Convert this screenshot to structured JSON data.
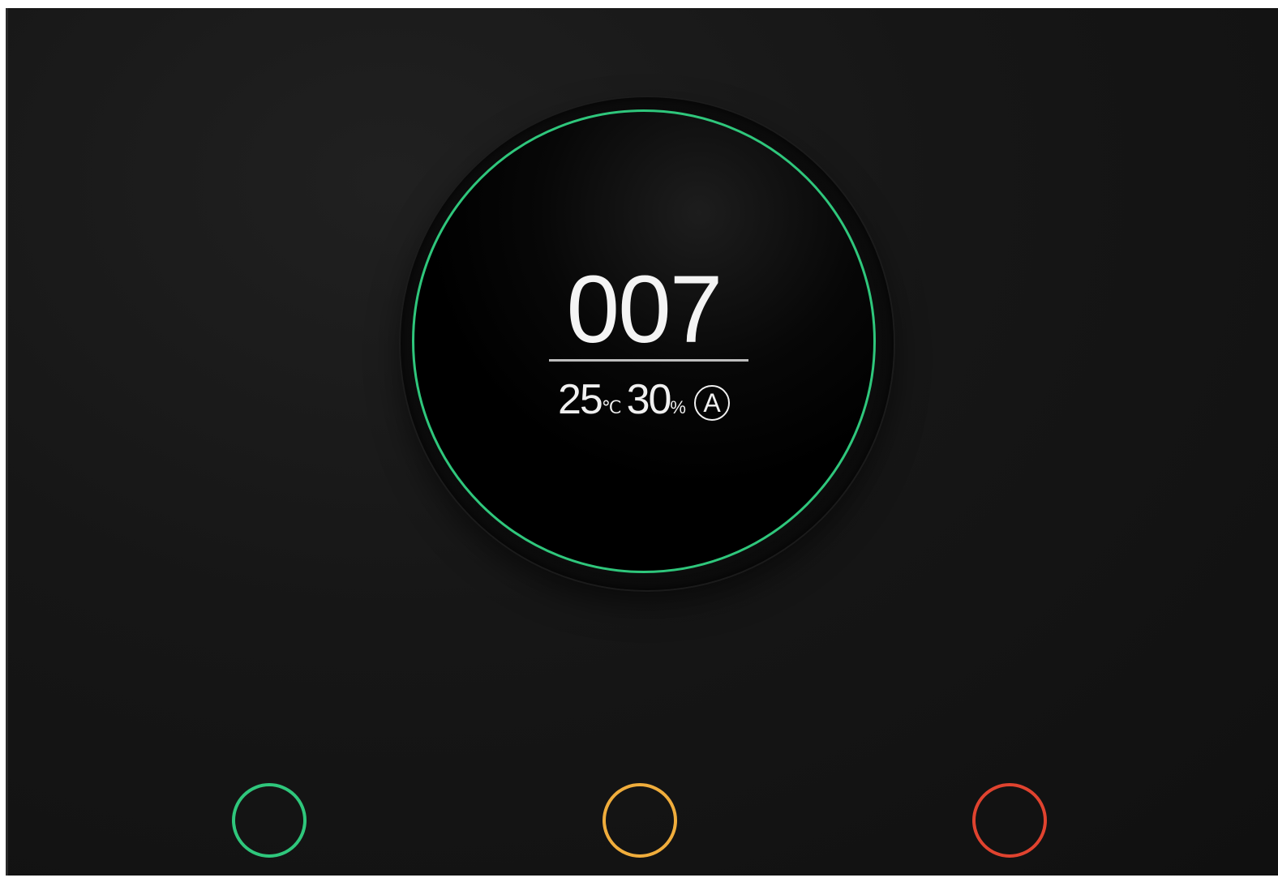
{
  "display": {
    "reading": "007",
    "temperature": "25",
    "temperature_unit": "℃",
    "humidity": "30",
    "humidity_unit": "%",
    "mode": "A"
  },
  "colors": {
    "ring": "#2fc77c",
    "good": "#2fc77c",
    "moderate": "#f0ad3c",
    "poor": "#e0432f",
    "background": "#151515"
  },
  "level_buttons": [
    {
      "icon": "circle-icon",
      "color": "#2fc77c"
    },
    {
      "icon": "circle-icon",
      "color": "#f0ad3c"
    },
    {
      "icon": "circle-icon",
      "color": "#e0432f"
    }
  ]
}
